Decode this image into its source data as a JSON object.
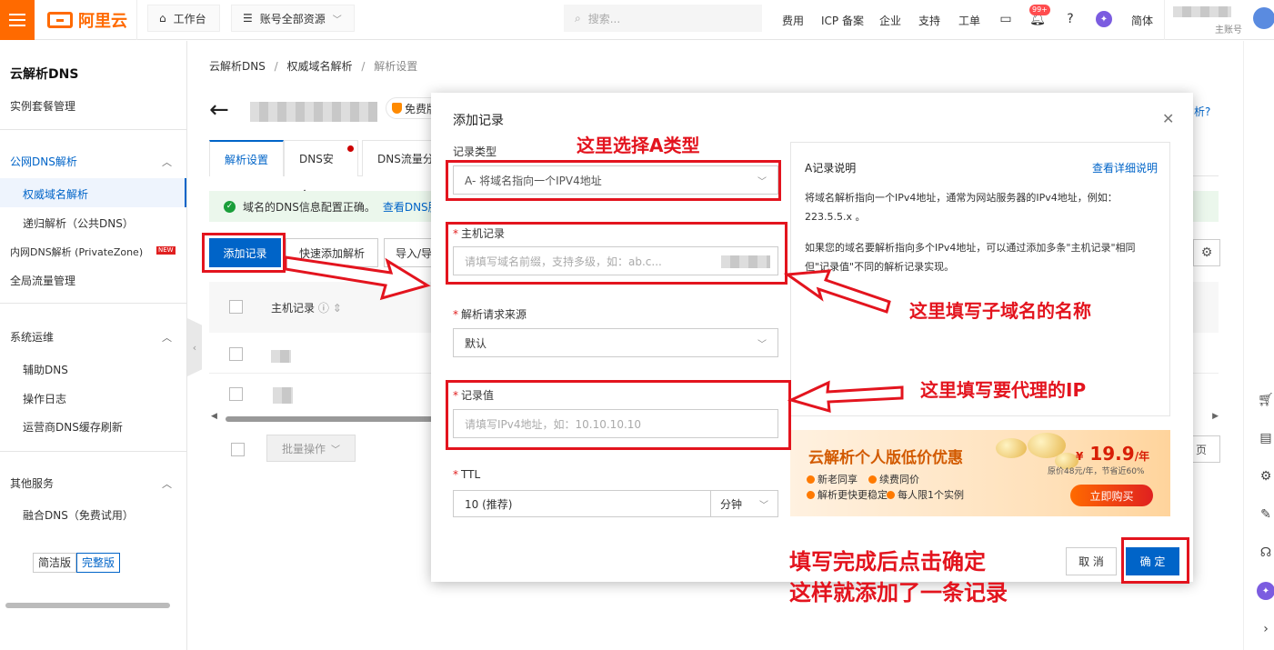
{
  "topbar": {
    "logo_text": "阿里云",
    "workbench": "工作台",
    "resource_scope": "账号全部资源",
    "search_placeholder": "搜索...",
    "links": [
      "费用",
      "ICP 备案",
      "企业",
      "支持",
      "工单"
    ],
    "notification_count": "99+",
    "language": "简体",
    "account_role": "主账号"
  },
  "sidebar": {
    "title": "云解析DNS",
    "items": {
      "instances": "实例套餐管理",
      "public_dns": "公网DNS解析",
      "authoritative": "权威域名解析",
      "recursive": "递归解析（公共DNS）",
      "private_zone": "内网DNS解析 (PrivateZone)",
      "new_badge": "NEW",
      "gtm": "全局流量管理",
      "ops": "系统运维",
      "aux_dns": "辅助DNS",
      "op_log": "操作日志",
      "isp_cache": "运营商DNS缓存刷新",
      "other": "其他服务",
      "fusion_dns": "融合DNS（免费试用）"
    },
    "version_simple": "简洁版",
    "version_full": "完整版"
  },
  "main": {
    "breadcrumb": [
      "云解析DNS",
      "权威域名解析",
      "解析设置"
    ],
    "free_tag": "免费版",
    "help_fragment": "析?",
    "tabs": [
      "解析设置",
      "DNS安全",
      "DNS流量分"
    ],
    "alert_text": "域名的DNS信息配置正确。",
    "alert_link": "查看DNS服",
    "add_record": "添加记录",
    "quick_add": "快速添加解析",
    "import_export": "导入/导",
    "col_host": "主机记录",
    "batch": "批量操作",
    "page_fragment": "页"
  },
  "modal": {
    "title": "添加记录",
    "record_type_label": "记录类型",
    "record_type_value": "A- 将域名指向一个IPV4地址",
    "host_label": "主机记录",
    "host_placeholder": "请填写域名前缀，支持多级，如：ab.c...",
    "source_label": "解析请求来源",
    "source_value": "默认",
    "value_label": "记录值",
    "value_placeholder": "请填写IPv4地址，如：10.10.10.10",
    "ttl_label": "TTL",
    "ttl_value": "10 (推荐)",
    "ttl_unit": "分钟",
    "cancel": "取 消",
    "confirm": "确 定",
    "info": {
      "title": "A记录说明",
      "link": "查看详细说明",
      "p1": "将域名解析指向一个IPv4地址，通常为网站服务器的IPv4地址，例如：223.5.5.x 。",
      "p2": "如果您的域名要解析指向多个IPv4地址，可以通过添加多条\"主机记录\"相同但\"记录值\"不同的解析记录实现。"
    },
    "promo": {
      "title": "云解析个人版低价优惠",
      "price_symbol": "¥",
      "price": "19.9",
      "price_unit": "/年",
      "original": "原价48元/年，节省近60%",
      "features": [
        "新老同享",
        "续费同价",
        "解析更快更稳定",
        "每人限1个实例"
      ],
      "buy": "立即购买"
    }
  },
  "annotations": {
    "select_type": "这里选择A类型",
    "subdomain": "这里填写子域名的名称",
    "proxy_ip": "这里填写要代理的IP",
    "finish_line1": "填写完成后点击确定",
    "finish_line2": "这样就添加了一条记录",
    "color": "#e3141e"
  },
  "colors": {
    "brand_orange": "#ff6a00",
    "primary_blue": "#0064c8"
  }
}
